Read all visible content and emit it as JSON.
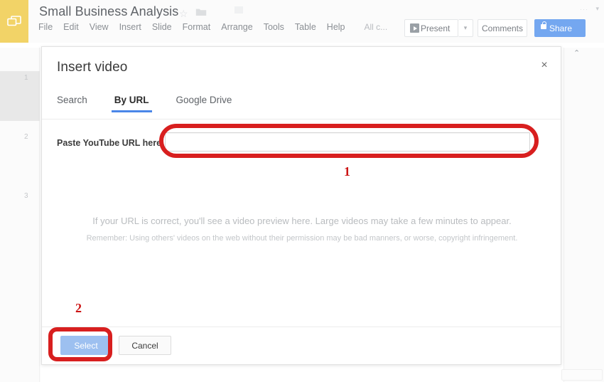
{
  "app": {
    "logo_icon": "slides-logo-icon",
    "doc_title": "Small Business Analysis",
    "star_icon": "star-icon",
    "folder_icon": "folder-icon",
    "menus": [
      "File",
      "Edit",
      "View",
      "Insert",
      "Slide",
      "Format",
      "Arrange",
      "Tools",
      "Table",
      "Help"
    ],
    "save_state": "All c...",
    "present_label": "Present",
    "present_caret": "▾",
    "comments_label": "Comments",
    "share_label": "Share",
    "topright_dots": "···",
    "topright_caret": "▾",
    "panel_collapse_icon": "chevron-up-icon",
    "panel_collapse_glyph": "⌃"
  },
  "filmstrip": {
    "slides": [
      {
        "number": "1",
        "selected": true
      },
      {
        "number": "2",
        "selected": false
      },
      {
        "number": "3",
        "selected": false
      }
    ]
  },
  "dialog": {
    "title": "Insert video",
    "close_icon": "close-icon",
    "close_glyph": "×",
    "tabs": [
      {
        "label": "Search",
        "active": false
      },
      {
        "label": "By URL",
        "active": true
      },
      {
        "label": "Google Drive",
        "active": false
      }
    ],
    "url_label": "Paste YouTube URL here:",
    "url_value": "",
    "url_placeholder": "",
    "helper_line_1": "If your URL is correct, you'll see a video preview here. Large videos may take a few minutes to appear.",
    "helper_line_2": "Remember: Using others' videos on the web without their permission may be bad manners, or worse, copyright infringement.",
    "select_label": "Select",
    "cancel_label": "Cancel"
  },
  "annotations": {
    "step_1": "1",
    "step_2": "2",
    "color": "#d81f1f"
  },
  "colors": {
    "slides_yellow": "#f2d367",
    "share_blue": "#74a7f0",
    "tab_underline_blue": "#4a86e8",
    "select_button_blue": "#9dc0f0",
    "annotation_red": "#d81f1f"
  }
}
